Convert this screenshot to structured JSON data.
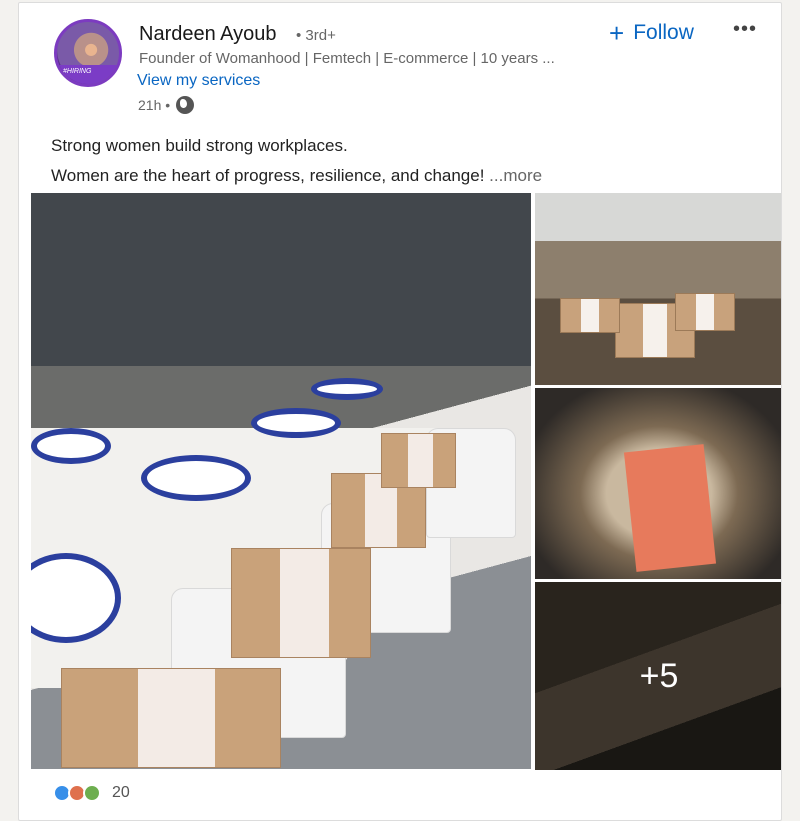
{
  "post": {
    "author_name": "Nardeen Ayoub",
    "degree": "• 3rd+",
    "headline": "Founder of Womanhood | Femtech | E-commerce | 10 years ...",
    "services_link": "View my services",
    "time": "21h •",
    "follow_label": "Follow",
    "more_menu": "•••",
    "text_line1": "Strong women build strong workplaces.",
    "text_line2": "Women are the heart of progress, resilience, and change!",
    "more_link": "...more",
    "extra_images": "+5",
    "reactions_count": "20"
  },
  "colors": {
    "accent": "#0a66c2",
    "avatar_ring": "#7c3bc0"
  },
  "icons": [
    "globe-icon",
    "plus-icon",
    "more-icon",
    "like-icon",
    "celebrate-icon",
    "love-icon"
  ]
}
